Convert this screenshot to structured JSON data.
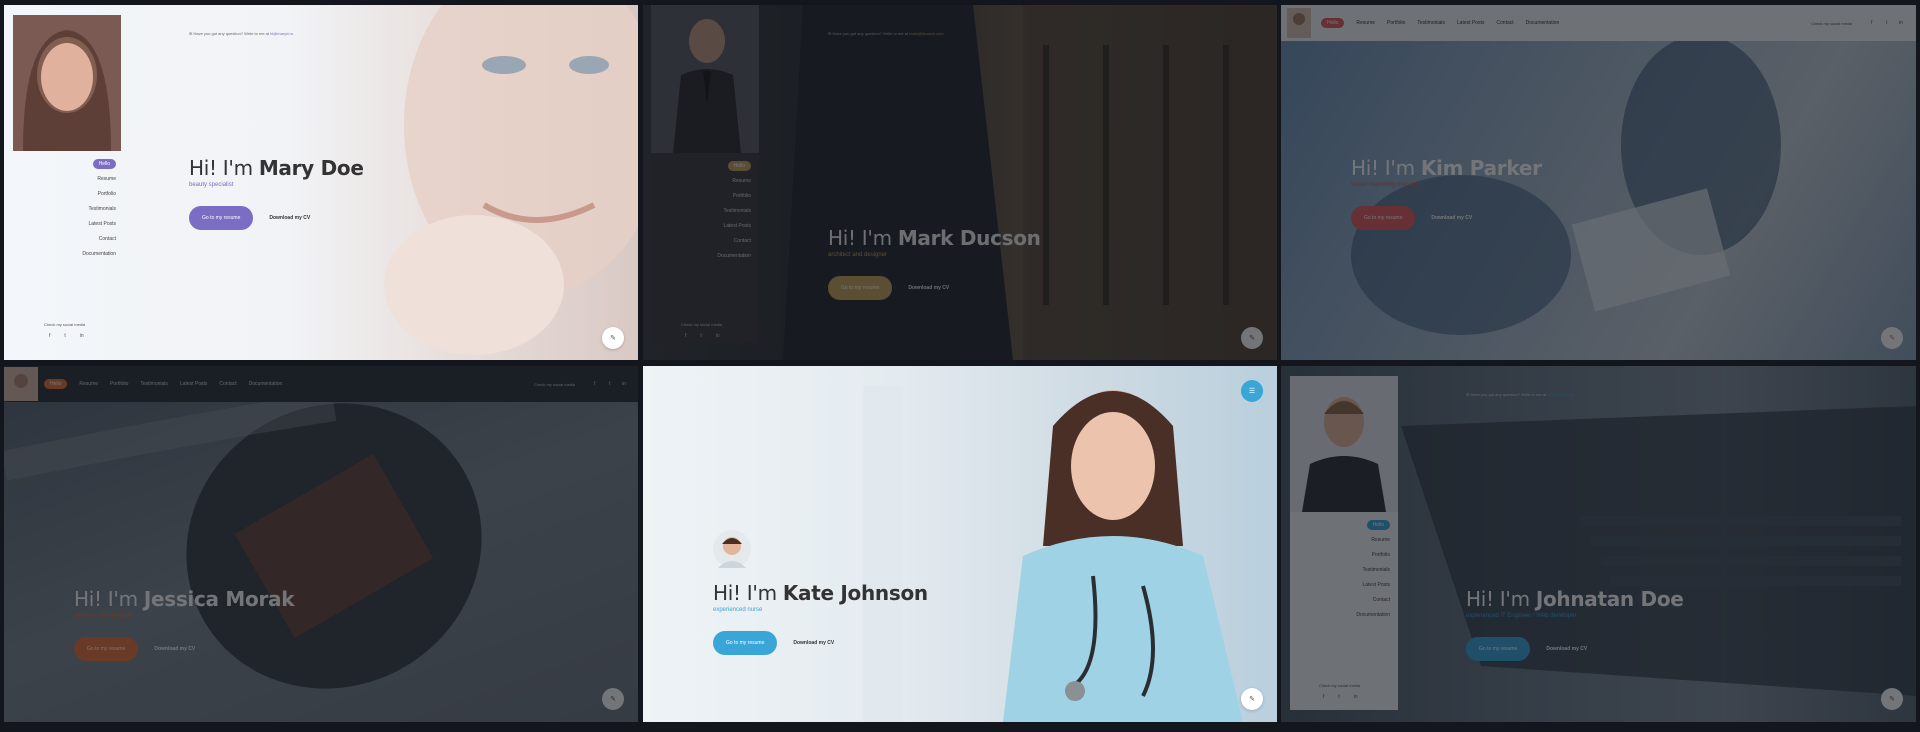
{
  "panels": [
    {
      "name": "Mary Doe",
      "first_line": "Hi! I'm",
      "subtitle": "beauty specialist",
      "primary_button": "Go to my resume",
      "secondary_button": "Download my CV",
      "accent": "#7b6cc4",
      "contact_text": "Have you got any question? Write to me at",
      "contact_email": "hi@maryd.ru",
      "menu": [
        "Hello",
        "Resume",
        "Portfolio",
        "Testimonials",
        "Latest Posts",
        "Contact",
        "Documentation"
      ],
      "social_label": "Check my social media",
      "social_icons": [
        "f",
        "t",
        "in"
      ],
      "circle_icon": "✎"
    },
    {
      "name": "Mark Ducson",
      "first_line": "Hi! I'm",
      "subtitle": "architect and designer",
      "primary_button": "Go to my resume",
      "secondary_button": "Download my CV",
      "accent": "#c8a25a",
      "contact_text": "Have you got any question? Write to me at",
      "contact_email": "mark@ducson.com",
      "menu": [
        "Hello",
        "Resume",
        "Portfolio",
        "Testimonials",
        "Latest Posts",
        "Contact",
        "Documentation"
      ],
      "social_label": "Check my social media",
      "social_icons": [
        "f",
        "t",
        "in"
      ],
      "circle_icon": "✎"
    },
    {
      "name": "Kim Parker",
      "first_line": "Hi! I'm",
      "subtitle": "senior marketing manager",
      "primary_button": "Go to my resume",
      "secondary_button": "Download my CV",
      "accent": "#e05b5b",
      "menu": [
        "Hello",
        "Resume",
        "Portfolio",
        "Testimonials",
        "Latest Posts",
        "Contact",
        "Documentation"
      ],
      "social_label": "Check my social media",
      "social_icons": [
        "f",
        "t",
        "in"
      ],
      "circle_icon": "✎"
    },
    {
      "name": "Jessica Morak",
      "first_line": "Hi! I'm",
      "subtitle": "architect and designer",
      "primary_button": "Go to my resume",
      "secondary_button": "Download my CV",
      "accent": "#e8743b",
      "menu": [
        "Hello",
        "Resume",
        "Portfolio",
        "Testimonials",
        "Latest Posts",
        "Contact",
        "Documentation"
      ],
      "social_label": "Check my social media",
      "social_icons": [
        "f",
        "t",
        "in"
      ],
      "circle_icon": "✎"
    },
    {
      "name": "Kate Johnson",
      "first_line": "Hi! I'm",
      "subtitle": "experienced nurse",
      "primary_button": "Go to my resume",
      "secondary_button": "Download my CV",
      "accent": "#3aa6d8",
      "circle_icon": "✎"
    },
    {
      "name": "Johnatan Doe",
      "first_line": "Hi! I'm",
      "subtitle": "experienced IT Engineer / Web developer",
      "primary_button": "Go to my resume",
      "secondary_button": "Download my CV",
      "accent": "#3aa6d8",
      "contact_text": "Have you got any question? Write to me at",
      "contact_email": "john@doe.com",
      "menu": [
        "Hello",
        "Resume",
        "Portfolio",
        "Testimonials",
        "Latest Posts",
        "Contact",
        "Documentation"
      ],
      "social_label": "Check my social media",
      "social_icons": [
        "f",
        "t",
        "in"
      ],
      "circle_icon": "✎"
    }
  ]
}
